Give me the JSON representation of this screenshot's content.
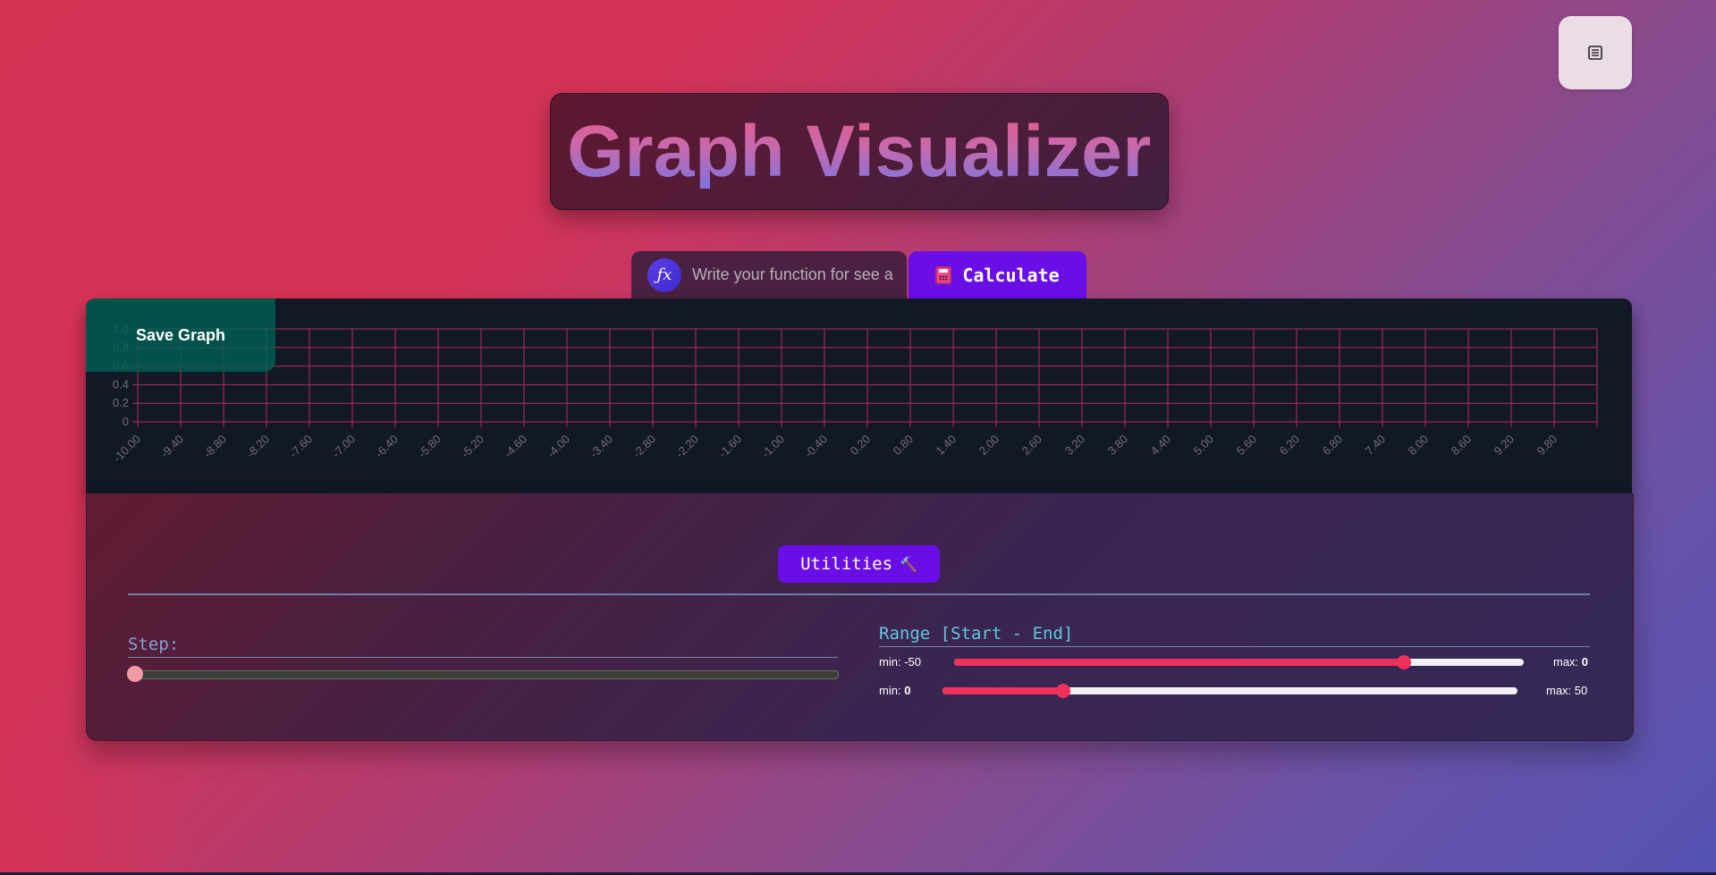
{
  "header": {
    "title": "Graph Visualizer",
    "menu_icon": "menu-list-icon"
  },
  "function_bar": {
    "fx_icon_text": "ƒx",
    "input_placeholder": "Write your function for see a graph",
    "input_value": "",
    "calculate_label": "Calculate",
    "calculate_icon": "calculator-icon"
  },
  "graph": {
    "save_label": "Save Graph",
    "grid_color": "#b42a63",
    "chart_data": {
      "type": "line",
      "series": [],
      "x": [
        "-10.00",
        "-9.40",
        "-8.80",
        "-8.20",
        "-7.60",
        "-7.00",
        "-6.40",
        "-5.80",
        "-5.20",
        "-4.60",
        "-4.00",
        "-3.40",
        "-2.80",
        "-2.20",
        "-1.60",
        "-1.00",
        "-0.40",
        "0.20",
        "0.80",
        "1.40",
        "2.00",
        "2.60",
        "3.20",
        "3.80",
        "4.40",
        "5.00",
        "5.60",
        "6.20",
        "6.80",
        "7.40",
        "8.00",
        "8.60",
        "9.20",
        "9.80"
      ],
      "y_ticks": [
        "0",
        "0.2",
        "0.4",
        "0.6",
        "0.8",
        "1.0"
      ],
      "ylim": [
        0,
        1
      ],
      "grid": true
    }
  },
  "utilities": {
    "button_label": "Utilities",
    "button_icon": "hammer-icon",
    "step": {
      "label": "Step:",
      "value": 0
    },
    "range": {
      "label": "Range [Start - End]",
      "start": {
        "min_prefix": "min:",
        "min_value": "-50",
        "max_prefix": "max:",
        "max_value": "0",
        "fill_fraction": 0.79
      },
      "end": {
        "min_prefix": "min:",
        "min_value": "0",
        "max_prefix": "max:",
        "max_value": "50",
        "fill_fraction": 0.21
      }
    },
    "accent_color": "#f0315c"
  }
}
